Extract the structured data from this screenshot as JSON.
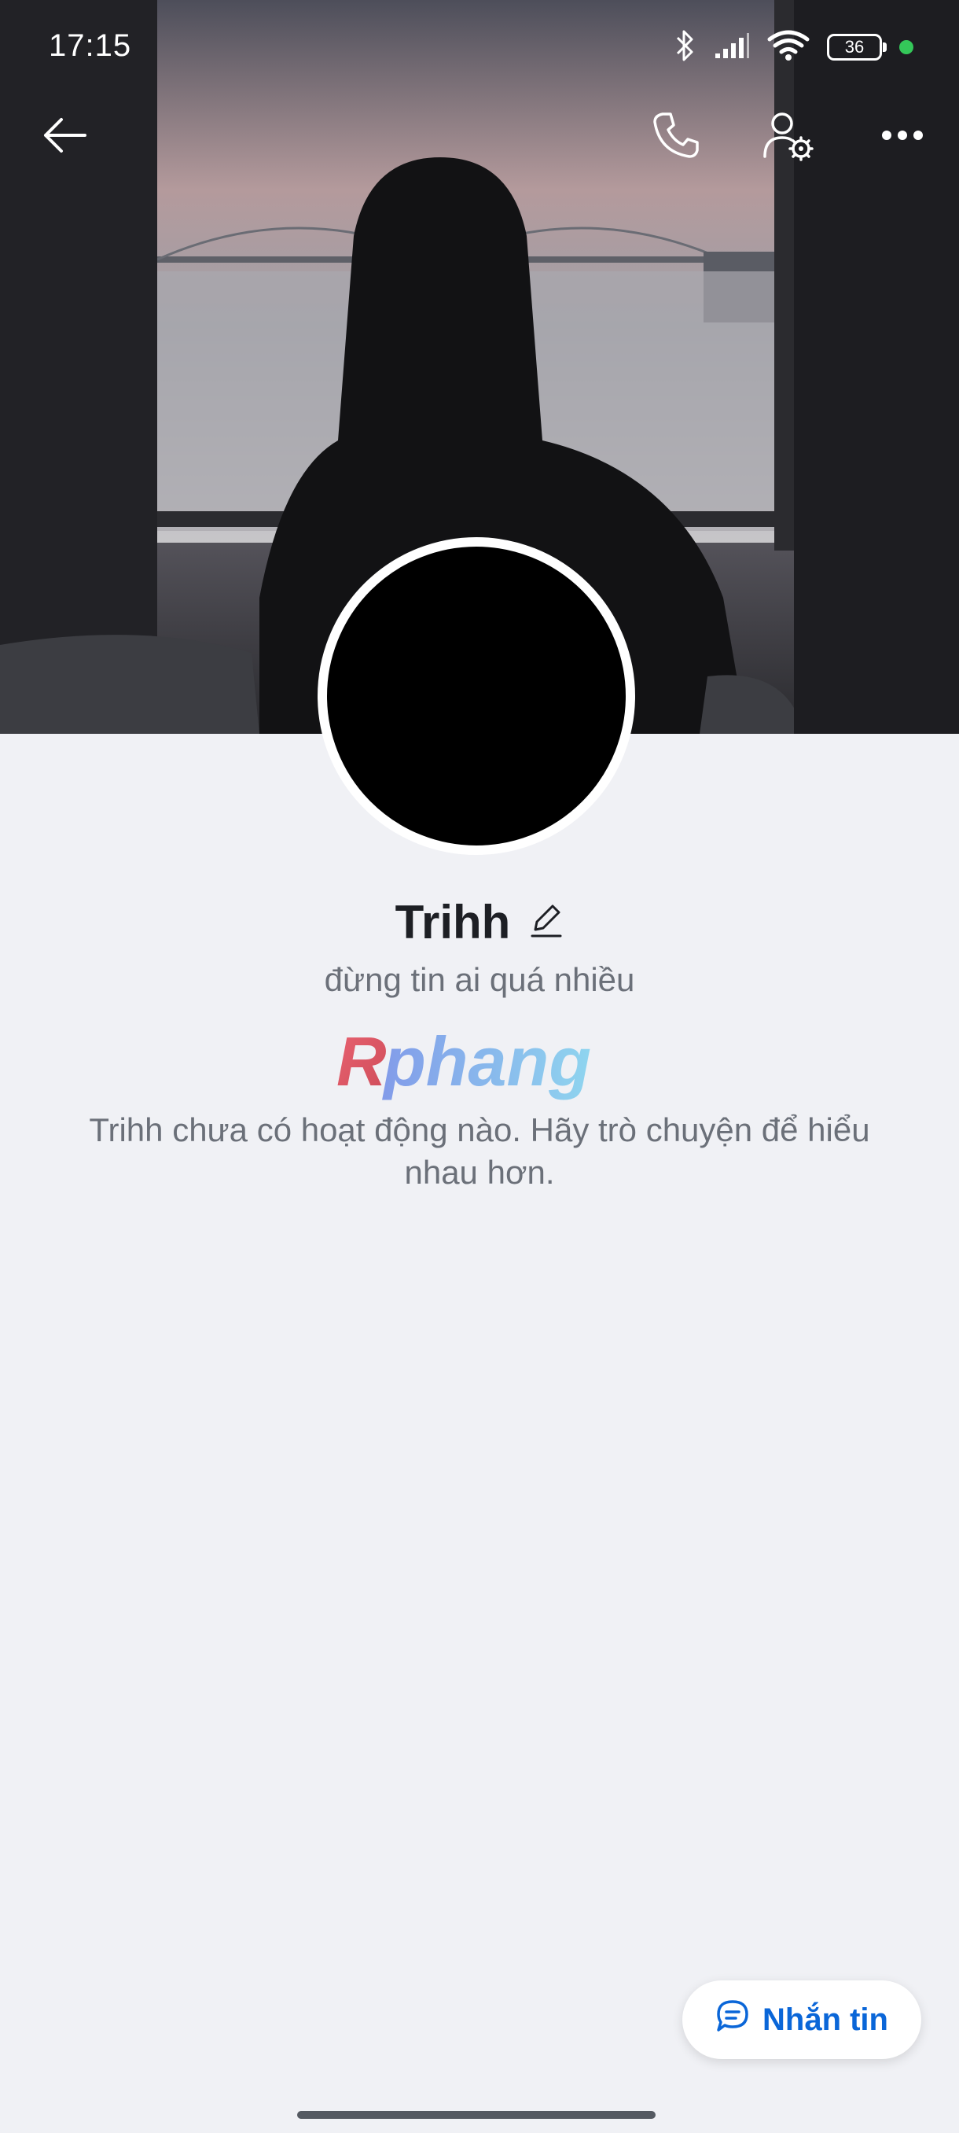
{
  "status_bar": {
    "time": "17:15",
    "battery_level": "36"
  },
  "toolbar": {
    "back_icon": "arrow-left-icon",
    "call_icon": "phone-icon",
    "settings_icon": "user-settings-icon",
    "more_icon": "more-horizontal-icon"
  },
  "profile": {
    "name": "Trihh",
    "edit_icon": "pencil-icon",
    "status": "đừng tin ai quá nhiều"
  },
  "feed": {
    "watermark": "Rphang",
    "empty_message": "Trihh chưa có hoạt động nào. Hãy trò chuyện để hiểu nhau hơn."
  },
  "actions": {
    "message_label": "Nhắn tin",
    "message_icon": "chat-bubble-icon"
  },
  "colors": {
    "background": "#f0f1f5",
    "accent": "#0a66d8",
    "text_primary": "#1d1f24",
    "text_secondary": "#6b7079"
  }
}
